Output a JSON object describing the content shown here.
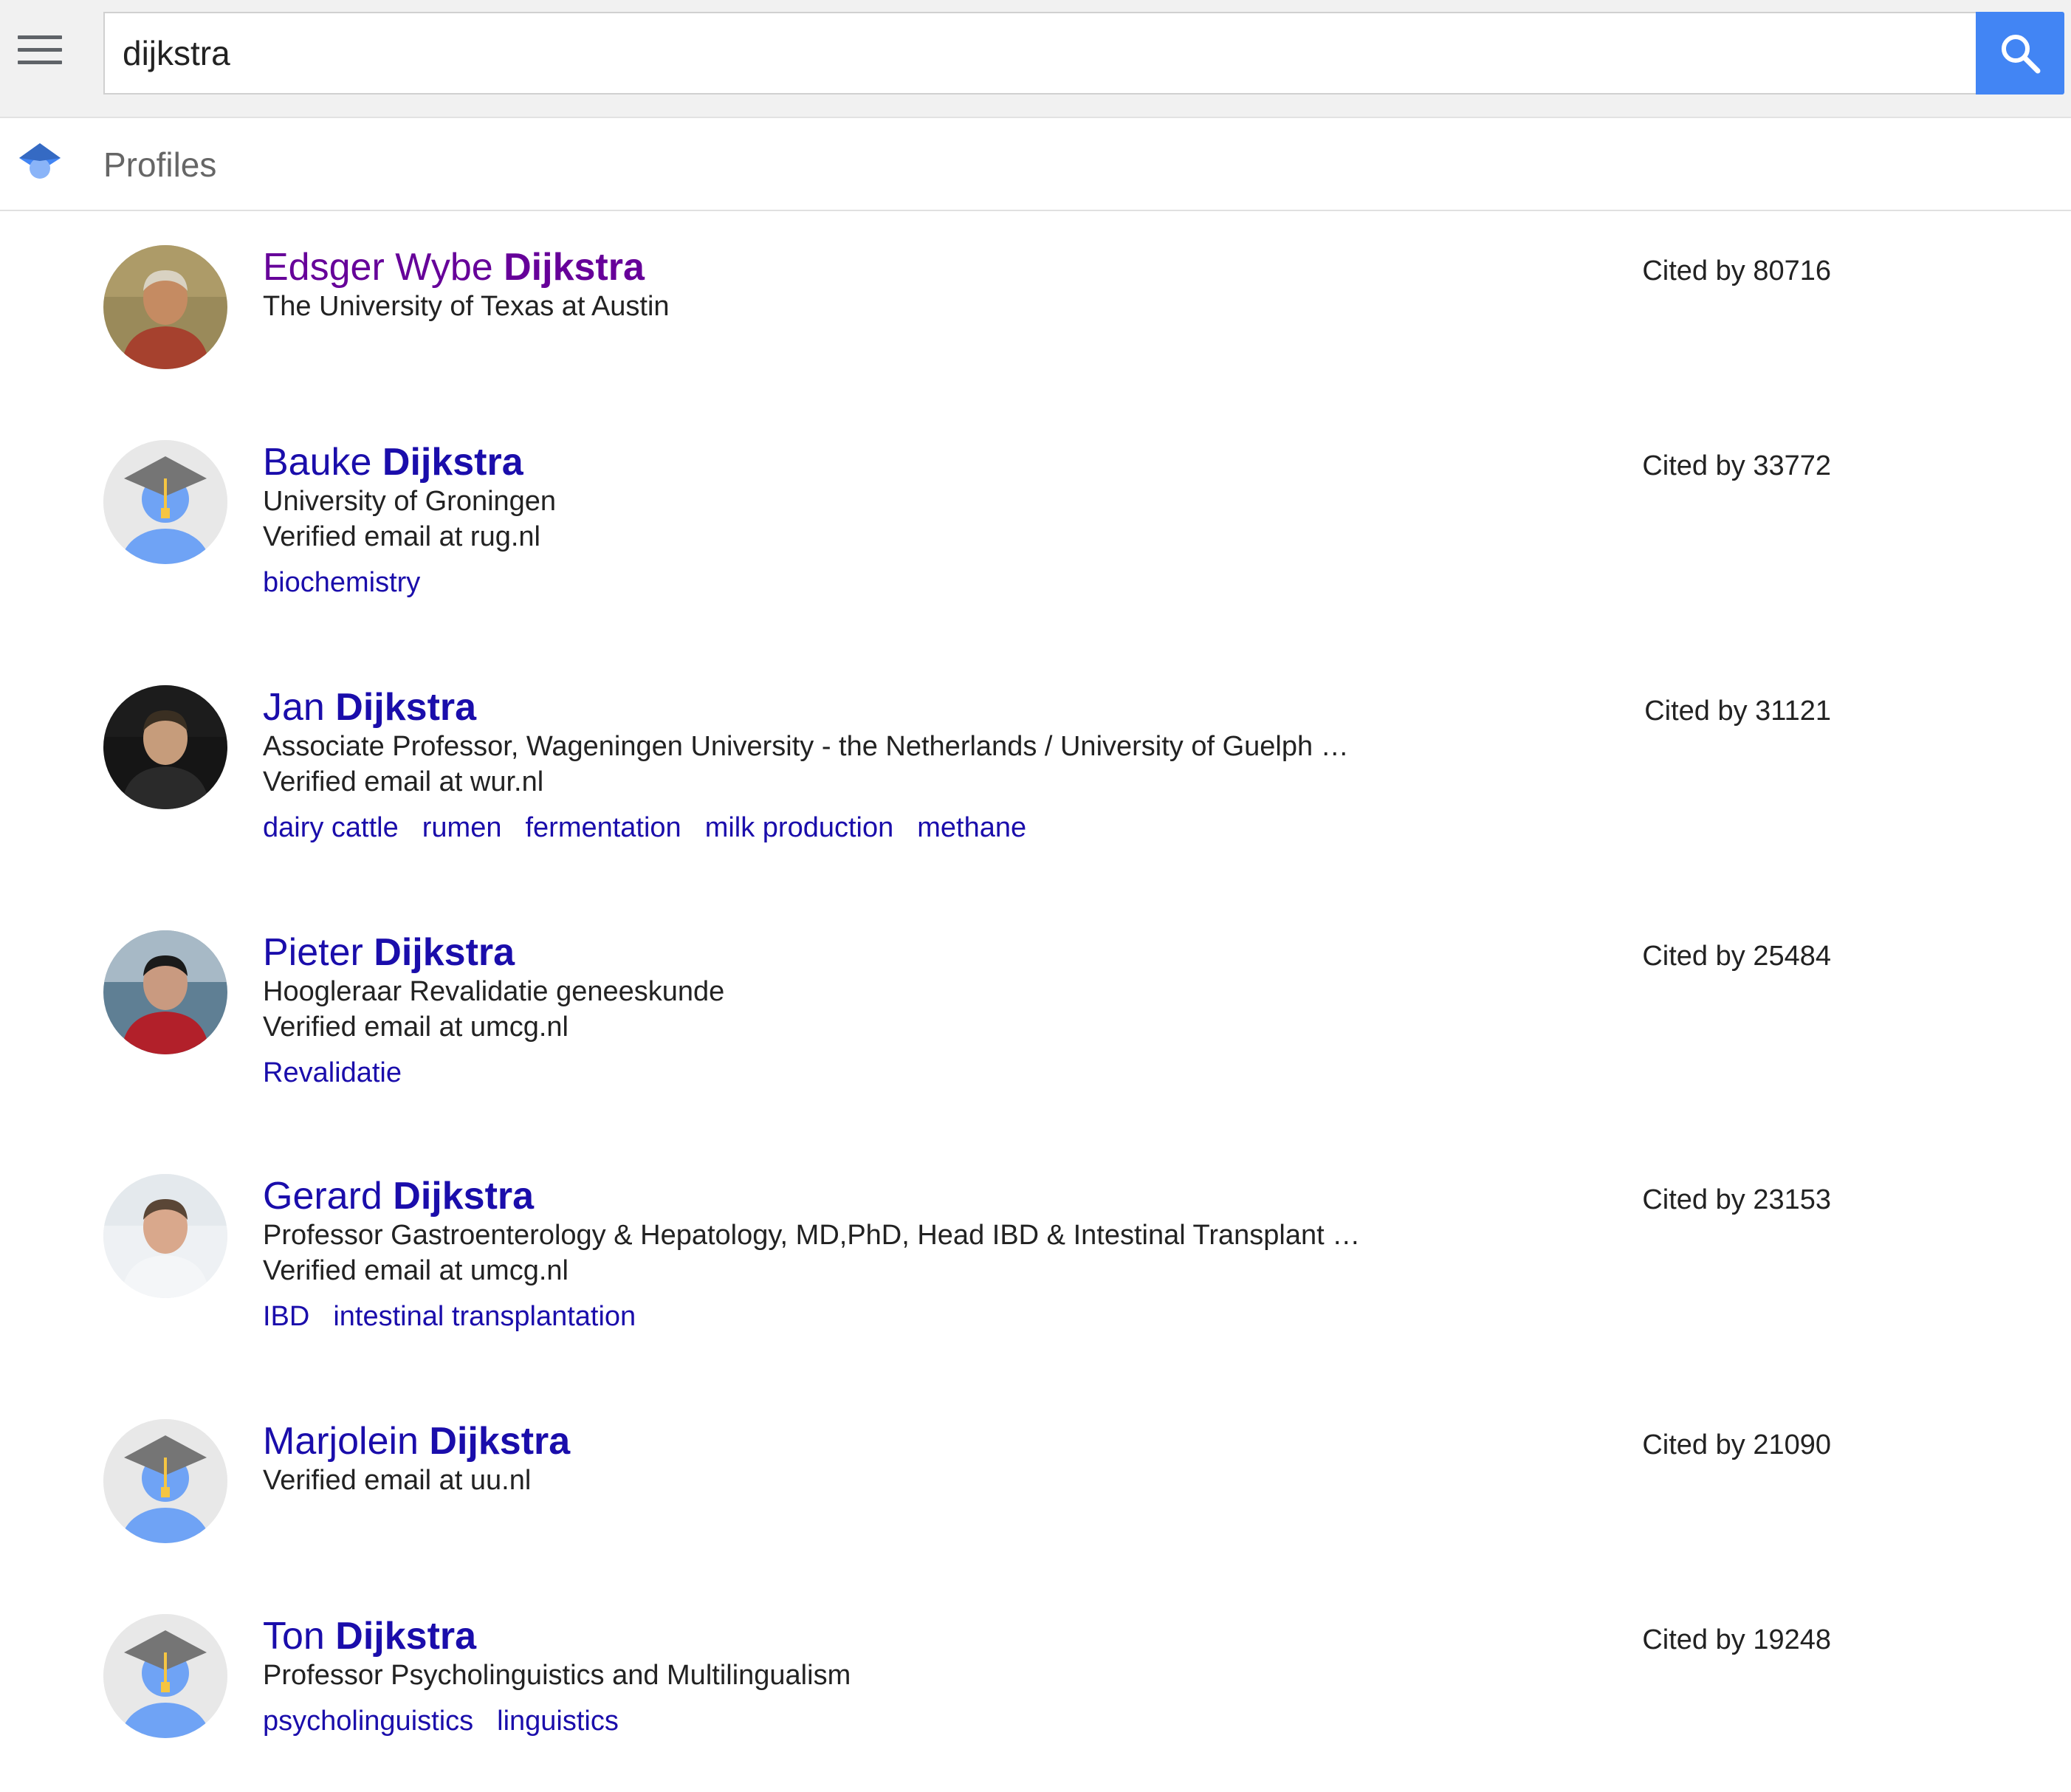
{
  "search": {
    "query": "dijkstra"
  },
  "section": {
    "title": "Profiles"
  },
  "cited_prefix": "Cited by",
  "profiles": [
    {
      "first": "Edsger Wybe",
      "last": "Dijkstra",
      "affiliation": "The University of Texas at Austin",
      "email": "",
      "tags": [],
      "cited": "Cited by 80716",
      "avatar": "photo-elderly-man",
      "visited": true
    },
    {
      "first": "Bauke",
      "last": "Dijkstra",
      "affiliation": "University of Groningen",
      "email": "Verified email at rug.nl",
      "tags": [
        "biochemistry"
      ],
      "cited": "Cited by 33772",
      "avatar": "placeholder-graduate-icon"
    },
    {
      "first": "Jan",
      "last": "Dijkstra",
      "affiliation": "Associate Professor, Wageningen University - the Netherlands / University of Guelph …",
      "email": "Verified email at wur.nl",
      "tags": [
        "dairy cattle",
        "rumen",
        "fermentation",
        "milk production",
        "methane"
      ],
      "cited": "Cited by 31121",
      "avatar": "photo-man-dark-background"
    },
    {
      "first": "Pieter",
      "last": "Dijkstra",
      "affiliation": "Hoogleraar Revalidatie geneeskunde",
      "email": "Verified email at umcg.nl",
      "tags": [
        "Revalidatie"
      ],
      "cited": "Cited by 25484",
      "avatar": "photo-man-red-jacket-sea"
    },
    {
      "first": "Gerard",
      "last": "Dijkstra",
      "affiliation": "Professor Gastroenterology & Hepatology, MD,PhD, Head IBD & Intestinal Transplant …",
      "email": "Verified email at umcg.nl",
      "tags": [
        "IBD",
        "intestinal transplantation"
      ],
      "cited": "Cited by 23153",
      "avatar": "photo-man-white-coat"
    },
    {
      "first": "Marjolein",
      "last": "Dijkstra",
      "affiliation": "",
      "email": "Verified email at uu.nl",
      "tags": [],
      "cited": "Cited by 21090",
      "avatar": "placeholder-graduate-icon"
    },
    {
      "first": "Ton",
      "last": "Dijkstra",
      "affiliation": "Professor Psycholinguistics and Multilingualism",
      "email": "",
      "tags": [
        "psycholinguistics",
        "linguistics"
      ],
      "cited": "Cited by 19248",
      "avatar": "placeholder-graduate-icon"
    }
  ],
  "colors": {
    "link": "#1a0dab",
    "visited": "#660099",
    "search_button": "#4285f4",
    "placeholder_body": "#6fa3f5"
  }
}
